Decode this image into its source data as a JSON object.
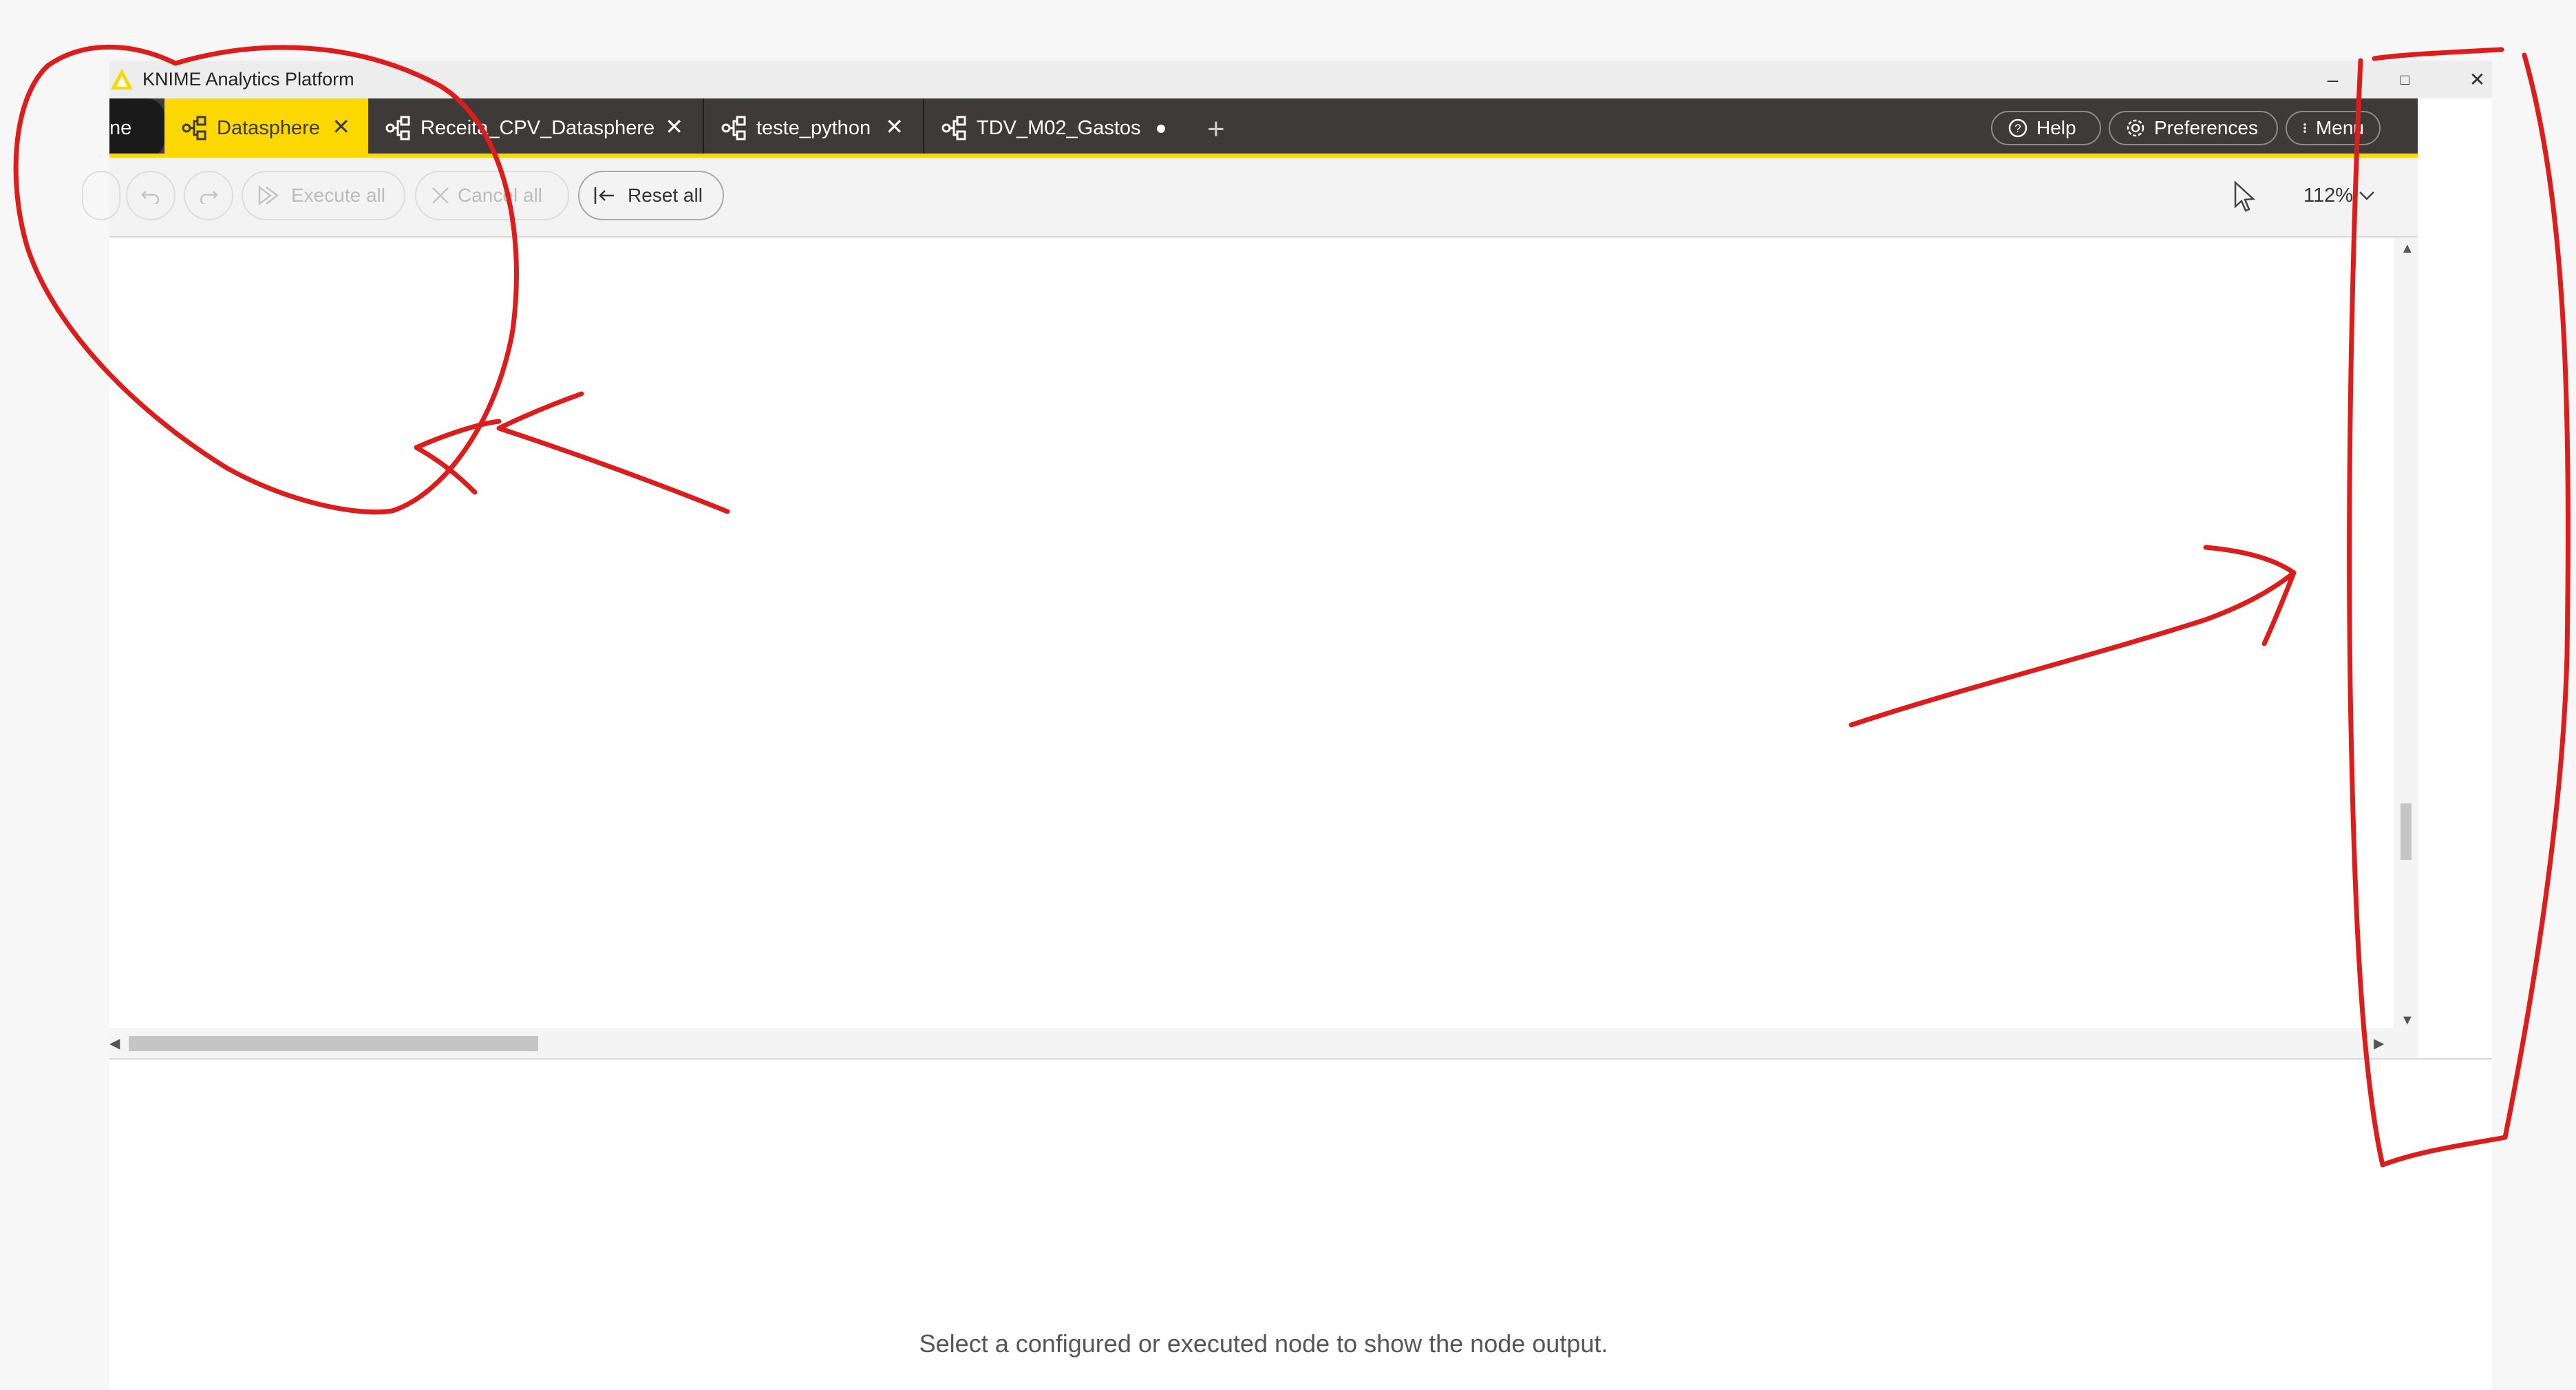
{
  "window": {
    "title": "KNIME Analytics Platform",
    "controls": [
      "–",
      "□",
      "✕"
    ]
  },
  "tabs": [
    {
      "label": "ne",
      "kind": "partial"
    },
    {
      "label": "Datasphere",
      "kind": "active",
      "close": "✕"
    },
    {
      "label": "Receita_CPV_Datasphere",
      "kind": "normal",
      "close": "✕"
    },
    {
      "label": "teste_python",
      "kind": "normal",
      "close": "✕"
    },
    {
      "label": "TDV_M02_Gastos",
      "kind": "normal",
      "unsaved": true
    }
  ],
  "new_tab": "+",
  "header_buttons": {
    "help": "Help",
    "preferences": "Preferences",
    "menu": "Menu"
  },
  "toolbar": {
    "execute_all": "Execute all",
    "cancel_all": "Cancel all",
    "reset_all": "Reset all",
    "zoom": "112%"
  },
  "output": {
    "message": "Select a configured or executed node to show the node output."
  },
  "colors": {
    "accent": "#fdd800",
    "tabbar": "#3e3a39",
    "annotation": "#dd1c1c"
  }
}
